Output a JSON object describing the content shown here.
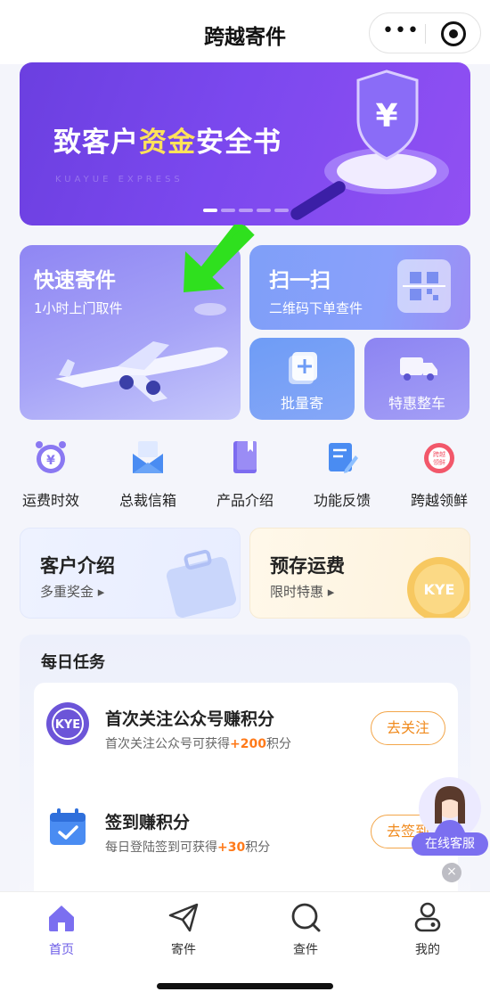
{
  "header": {
    "title": "跨越寄件",
    "more_icon": "more-dots-icon",
    "close_icon": "target-icon"
  },
  "banner": {
    "headline_pre": "致客户",
    "headline_highlight": "资金",
    "headline_post": "安全书",
    "watermark": "KUAYUE EXPRESS",
    "highlight_color": "#ffe25a"
  },
  "quick_actions": {
    "quick_send": {
      "title": "快速寄件",
      "subtitle": "1小时上门取件"
    },
    "scan": {
      "title": "扫一扫",
      "subtitle": "二维码下单查件"
    },
    "bulk": {
      "label": "批量寄"
    },
    "truck": {
      "label": "特惠整车"
    }
  },
  "menu": [
    {
      "label": "运费时效",
      "icon": "alarm-clock-yen-icon"
    },
    {
      "label": "总裁信箱",
      "icon": "mail-icon"
    },
    {
      "label": "产品介绍",
      "icon": "book-icon"
    },
    {
      "label": "功能反馈",
      "icon": "feedback-icon"
    },
    {
      "label": "跨越领鲜",
      "icon": "fresh-badge-icon"
    }
  ],
  "promos": {
    "customer": {
      "title": "客户介绍",
      "subtitle": "多重奖金 ▸"
    },
    "prepay": {
      "title": "预存运费",
      "subtitle": "限时特惠 ▸",
      "coin_text": "KYE"
    }
  },
  "tasks": {
    "header": "每日任务",
    "items": [
      {
        "title": "首次关注公众号赚积分",
        "desc_pre": "首次关注公众号可获得",
        "points": "+200",
        "desc_post": "积分",
        "button": "去关注",
        "logo_text": "KYE"
      },
      {
        "title": "签到赚积分",
        "desc_pre": "每日登陆签到可获得",
        "points": "+30",
        "desc_post": "积分",
        "button": "去签到"
      }
    ]
  },
  "service": {
    "label": "在线客服",
    "close": "×"
  },
  "tabbar": [
    {
      "label": "首页",
      "icon": "home-icon",
      "active": true
    },
    {
      "label": "寄件",
      "icon": "send-plane-icon",
      "active": false
    },
    {
      "label": "查件",
      "icon": "search-icon",
      "active": false
    },
    {
      "label": "我的",
      "icon": "profile-icon",
      "active": false
    }
  ],
  "colors": {
    "accent": "#6c5ce7",
    "points": "#ff7a1a",
    "button_border": "#f3a64a"
  }
}
